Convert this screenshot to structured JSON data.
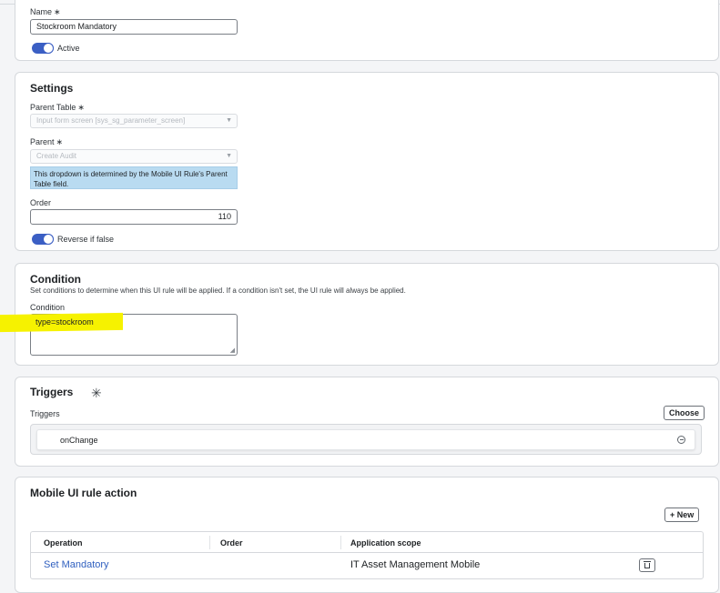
{
  "header": {
    "name_label": "Name",
    "required_mark": "∗",
    "name_value": "Stockroom Mandatory",
    "active_label": "Active"
  },
  "settings": {
    "title": "Settings",
    "parent_table_label": "Parent Table",
    "parent_table_value": "Input form screen [sys_sg_parameter_screen]",
    "parent_label": "Parent",
    "parent_value": "Create Audit",
    "tooltip": "This dropdown is determined by the Mobile UI Rule's Parent Table field.",
    "order_label": "Order",
    "order_value": "110",
    "reverse_label": "Reverse if false"
  },
  "condition": {
    "title": "Condition",
    "description": "Set conditions to determine when this UI rule will be applied. If a condition isn't set, the UI rule will always be applied.",
    "field_label": "Condition",
    "value": "type=stockroom"
  },
  "triggers": {
    "title": "Triggers",
    "field_label": "Triggers",
    "choose_label": "Choose",
    "items": [
      "onChange"
    ]
  },
  "actions": {
    "title": "Mobile UI rule action",
    "new_label": "+ New",
    "columns": [
      "Operation",
      "Order",
      "Application scope"
    ],
    "rows": [
      {
        "operation": "Set Mandatory",
        "order": "",
        "scope": "IT Asset Management Mobile"
      }
    ]
  },
  "colors": {
    "accent": "#3b5fc4",
    "link": "#2f5fbf",
    "highlight": "#f6f200",
    "tooltip_bg": "#b9dbf1"
  }
}
